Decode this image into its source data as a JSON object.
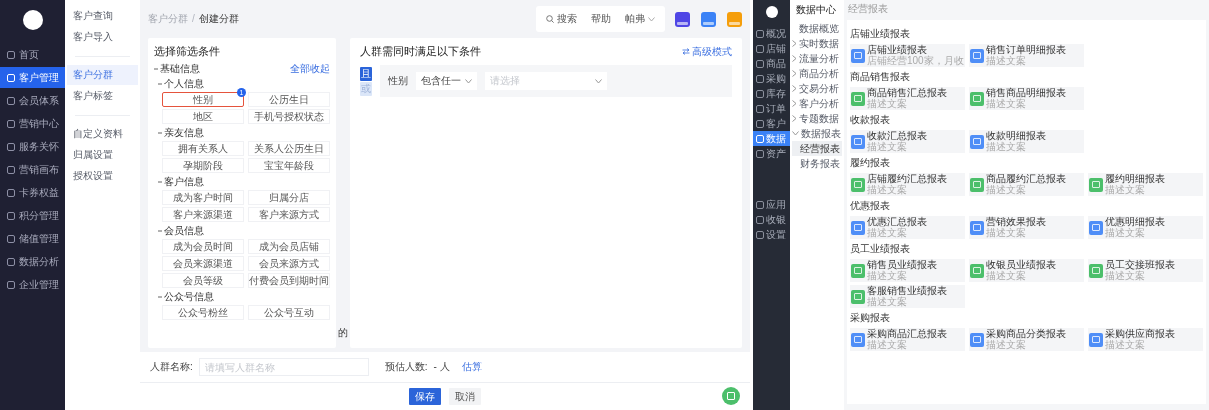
{
  "left_app": {
    "nav": [
      {
        "label": "首页",
        "selected": false
      },
      {
        "label": "客户管理",
        "selected": true
      },
      {
        "label": "会员体系",
        "selected": false
      },
      {
        "label": "营销中心",
        "selected": false
      },
      {
        "label": "服务关怀",
        "selected": false
      },
      {
        "label": "营销画布",
        "selected": false
      },
      {
        "label": "卡券权益",
        "selected": false
      },
      {
        "label": "积分管理",
        "selected": false
      },
      {
        "label": "储值管理",
        "selected": false
      },
      {
        "label": "数据分析",
        "selected": false
      },
      {
        "label": "企业管理",
        "selected": false
      }
    ],
    "subnav_groups": [
      [
        {
          "label": "客户查询",
          "selected": false
        },
        {
          "label": "客户导入",
          "selected": false
        }
      ],
      [
        {
          "label": "客户分群",
          "selected": true
        },
        {
          "label": "客户标签",
          "selected": false
        }
      ],
      [
        {
          "label": "自定义资料",
          "selected": false
        },
        {
          "label": "归属设置",
          "selected": false
        },
        {
          "label": "授权设置",
          "selected": false
        }
      ]
    ],
    "breadcrumb": [
      "客户分群",
      "创建分群"
    ],
    "breadcrumb_separator": "/",
    "header": {
      "search": "搜索",
      "help": "帮助",
      "user": "帕弗",
      "apps": [
        {
          "color": "#4f46e5"
        },
        {
          "color": "#3b82f6"
        },
        {
          "color": "#f59e0b"
        }
      ]
    },
    "filter_panel": {
      "title": "选择筛选条件",
      "section": "基础信息",
      "collapse_all": "全部收起",
      "groups": [
        {
          "title": "个人信息",
          "options": [
            {
              "label": "性别",
              "selected": true,
              "badge": "1"
            },
            {
              "label": "公历生日",
              "selected": false
            },
            {
              "label": "地区",
              "selected": false
            },
            {
              "label": "手机号授权状态",
              "selected": false
            }
          ]
        },
        {
          "title": "亲友信息",
          "options": [
            {
              "label": "拥有关系人",
              "selected": false
            },
            {
              "label": "关系人公历生日",
              "selected": false
            },
            {
              "label": "孕期阶段",
              "selected": false
            },
            {
              "label": "宝宝年龄段",
              "selected": false
            }
          ]
        },
        {
          "title": "客户信息",
          "options": [
            {
              "label": "成为客户时间",
              "selected": false
            },
            {
              "label": "归属分店",
              "selected": false
            },
            {
              "label": "客户来源渠道",
              "selected": false
            },
            {
              "label": "客户来源方式",
              "selected": false
            }
          ]
        },
        {
          "title": "会员信息",
          "options": [
            {
              "label": "成为会员时间",
              "selected": false
            },
            {
              "label": "成为会员店铺",
              "selected": false
            },
            {
              "label": "会员来源渠道",
              "selected": false
            },
            {
              "label": "会员来源方式",
              "selected": false
            },
            {
              "label": "会员等级",
              "selected": false
            },
            {
              "label": "付费会员到期时间",
              "selected": false
            }
          ]
        },
        {
          "title": "公众号信息",
          "options": [
            {
              "label": "公众号粉丝",
              "selected": false
            },
            {
              "label": "公众号互动",
              "selected": false
            }
          ]
        }
      ]
    },
    "stray_text": "的",
    "conditions": {
      "title": "人群需同时满足以下条件",
      "advanced": "高级模式",
      "logic": [
        {
          "label": "且",
          "selected": true
        },
        {
          "label": "或",
          "selected": false
        }
      ],
      "rows": [
        {
          "field": "性别",
          "operator": "包含任一",
          "placeholder": "请选择"
        }
      ]
    },
    "footer": {
      "name_label": "人群名称:",
      "name_placeholder": "请填写人群名称",
      "estimate_label": "预估人数:",
      "estimate_value": "- 人",
      "estimate_link": "估算",
      "buttons": [
        {
          "label": "保存",
          "kind": "primary"
        },
        {
          "label": "取消",
          "kind": "default"
        }
      ]
    }
  },
  "right_app": {
    "nav": [
      {
        "label": "概况",
        "selected": false
      },
      {
        "label": "店铺",
        "selected": false
      },
      {
        "label": "商品",
        "selected": false
      },
      {
        "label": "采购",
        "selected": false
      },
      {
        "label": "库存",
        "selected": false
      },
      {
        "label": "订单",
        "selected": false
      },
      {
        "label": "客户",
        "selected": false
      },
      {
        "label": "数据",
        "selected": true
      },
      {
        "label": "资产",
        "selected": false
      }
    ],
    "nav_bottom": [
      {
        "label": "应用",
        "selected": false
      },
      {
        "label": "收银",
        "selected": false
      },
      {
        "label": "设置",
        "selected": false
      }
    ],
    "subnav_title": "数据中心",
    "subnav": [
      {
        "label": "数据概览",
        "kind": "link",
        "selected": false
      },
      {
        "label": "实时数据",
        "kind": "group",
        "expanded": false
      },
      {
        "label": "流量分析",
        "kind": "group",
        "expanded": false
      },
      {
        "label": "商品分析",
        "kind": "group",
        "expanded": false
      },
      {
        "label": "交易分析",
        "kind": "group",
        "expanded": false
      },
      {
        "label": "客户分析",
        "kind": "group",
        "expanded": false
      },
      {
        "label": "专题数据",
        "kind": "group",
        "expanded": false
      },
      {
        "label": "数据报表",
        "kind": "group",
        "expanded": true,
        "children": [
          {
            "label": "经营报表",
            "kind": "link",
            "selected": true
          },
          {
            "label": "财务报表",
            "kind": "link",
            "selected": false
          }
        ]
      }
    ],
    "breadcrumb": "经营报表",
    "sections": [
      {
        "title": "店铺业绩报表",
        "reports": [
          {
            "title": "店铺业绩报表",
            "desc": "店铺经营100家，月收",
            "color": "#4f8ef7"
          },
          {
            "title": "销售订单明细报表",
            "desc": "描述文案",
            "color": "#4f8ef7"
          }
        ]
      },
      {
        "title": "商品销售报表",
        "reports": [
          {
            "title": "商品销售汇总报表",
            "desc": "描述文案",
            "color": "#4cbf6b"
          },
          {
            "title": "销售商品明细报表",
            "desc": "描述文案",
            "color": "#4cbf6b"
          }
        ]
      },
      {
        "title": "收款报表",
        "reports": [
          {
            "title": "收款汇总报表",
            "desc": "描述文案",
            "color": "#4f8ef7"
          },
          {
            "title": "收款明细报表",
            "desc": "描述文案",
            "color": "#4f8ef7"
          }
        ]
      },
      {
        "title": "履约报表",
        "reports": [
          {
            "title": "店铺履约汇总报表",
            "desc": "描述文案",
            "color": "#4cbf6b"
          },
          {
            "title": "商品履约汇总报表",
            "desc": "描述文案",
            "color": "#4cbf6b"
          },
          {
            "title": "履约明细报表",
            "desc": "描述文案",
            "color": "#4cbf6b"
          }
        ]
      },
      {
        "title": "优惠报表",
        "reports": [
          {
            "title": "优惠汇总报表",
            "desc": "描述文案",
            "color": "#4f8ef7"
          },
          {
            "title": "营销效果报表",
            "desc": "描述文案",
            "color": "#4f8ef7"
          },
          {
            "title": "优惠明细报表",
            "desc": "描述文案",
            "color": "#4f8ef7"
          }
        ]
      },
      {
        "title": "员工业绩报表",
        "reports": [
          {
            "title": "销售员业绩报表",
            "desc": "描述文案",
            "color": "#4cbf6b"
          },
          {
            "title": "收银员业绩报表",
            "desc": "描述文案",
            "color": "#4cbf6b"
          },
          {
            "title": "员工交接班报表",
            "desc": "描述文案",
            "color": "#4cbf6b"
          },
          {
            "title": "客服销售业绩报表",
            "desc": "描述文案",
            "color": "#4cbf6b"
          }
        ]
      },
      {
        "title": "采购报表",
        "reports": [
          {
            "title": "采购商品汇总报表",
            "desc": "描述文案",
            "color": "#4f8ef7"
          },
          {
            "title": "采购商品分类报表",
            "desc": "描述文案",
            "color": "#4f8ef7"
          },
          {
            "title": "采购供应商报表",
            "desc": "描述文案",
            "color": "#4f8ef7"
          }
        ]
      }
    ]
  }
}
